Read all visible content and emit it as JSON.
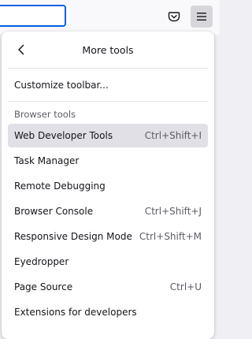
{
  "panel": {
    "title": "More tools",
    "customize_label": "Customize toolbar...",
    "section_label": "Browser tools",
    "items": [
      {
        "label": "Web Developer Tools",
        "shortcut": "Ctrl+Shift+I"
      },
      {
        "label": "Task Manager",
        "shortcut": ""
      },
      {
        "label": "Remote Debugging",
        "shortcut": ""
      },
      {
        "label": "Browser Console",
        "shortcut": "Ctrl+Shift+J"
      },
      {
        "label": "Responsive Design Mode",
        "shortcut": "Ctrl+Shift+M"
      },
      {
        "label": "Eyedropper",
        "shortcut": ""
      },
      {
        "label": "Page Source",
        "shortcut": "Ctrl+U"
      },
      {
        "label": "Extensions for developers",
        "shortcut": ""
      }
    ]
  },
  "icons": {
    "back": "chevron-left-icon",
    "pocket": "pocket-icon",
    "menu": "hamburger-menu-icon"
  },
  "colors": {
    "accent": "#0061e0",
    "hover": "#e0e0e6"
  }
}
